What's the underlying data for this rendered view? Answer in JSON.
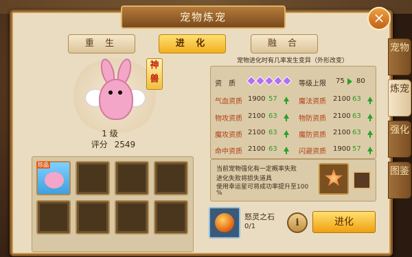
{
  "window": {
    "title": "宠物炼宠",
    "close_icon": "close-icon"
  },
  "top_tabs": [
    {
      "label": "重 生",
      "active": false
    },
    {
      "label": "进 化",
      "active": true
    },
    {
      "label": "融 合",
      "active": false
    }
  ],
  "side_tabs": [
    {
      "label": "宠物",
      "active": false
    },
    {
      "label": "炼宠",
      "active": true
    },
    {
      "label": "强化",
      "active": false
    },
    {
      "label": "图鉴",
      "active": false
    }
  ],
  "pet": {
    "badge": "神兽",
    "level_label": "1 级",
    "score_label": "评分",
    "score_value": "2549"
  },
  "slots": {
    "first_badge": "珍品"
  },
  "evolution": {
    "note": "宠物进化时有几率发生变异（外形改变）",
    "aptitude_label": "资　质",
    "aptitude_gems": 5,
    "level_cap_label": "等级上限",
    "level_cap_from": "75",
    "level_cap_to": "80",
    "stats": [
      {
        "name": "气血资质",
        "value": "1900",
        "bonus": "57"
      },
      {
        "name": "魔法资质",
        "value": "2100",
        "bonus": "63"
      },
      {
        "name": "物攻资质",
        "value": "2100",
        "bonus": "63"
      },
      {
        "name": "物防资质",
        "value": "2100",
        "bonus": "63"
      },
      {
        "name": "魔攻资质",
        "value": "2100",
        "bonus": "63"
      },
      {
        "name": "魔防资质",
        "value": "2100",
        "bonus": "63"
      },
      {
        "name": "命中资质",
        "value": "2100",
        "bonus": "63"
      },
      {
        "name": "闪避资质",
        "value": "1900",
        "bonus": "57"
      }
    ]
  },
  "warning": {
    "line1": "当前宠物强化有一定概率失败",
    "line2": "进化失败将损失道具",
    "line3": "使用幸运星可将成功率提升至100",
    "line4": "%"
  },
  "material": {
    "name": "怒灵之石",
    "count": "0/1"
  },
  "info_button": "i",
  "evolve_button": "进化"
}
